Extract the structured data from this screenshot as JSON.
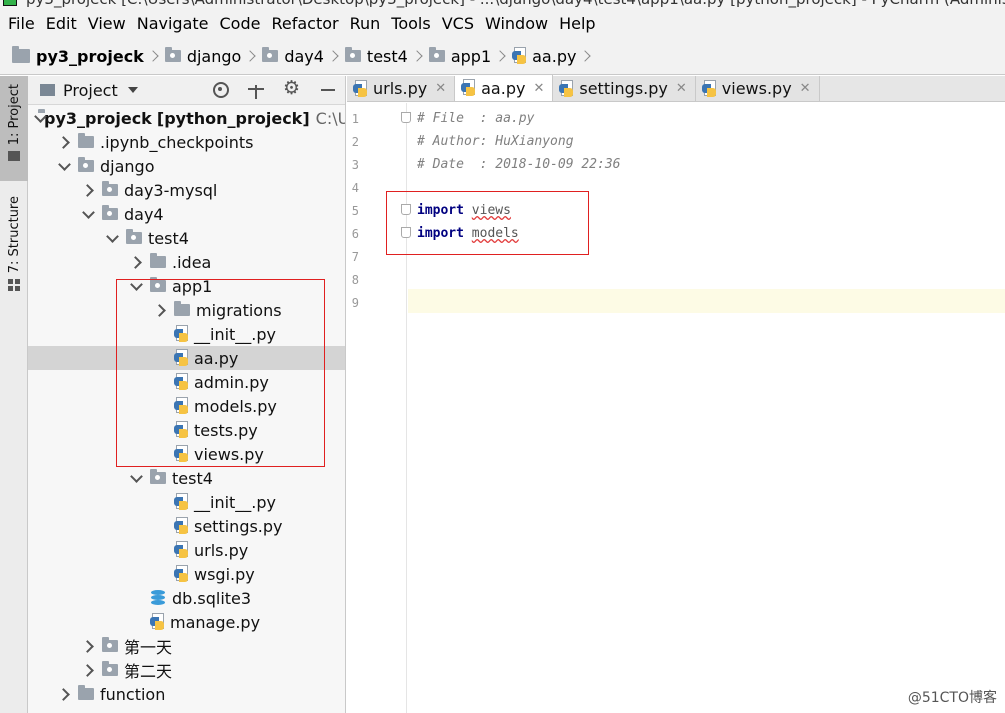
{
  "titlebar": {
    "text": "py3_projeck [C:\\Users\\Administrator\\Desktop\\py3_projeck] - ...\\django\\day4\\test4\\app1\\aa.py [python_projeck] - PyCharm (Administrator)"
  },
  "menu": [
    "File",
    "Edit",
    "View",
    "Navigate",
    "Code",
    "Refactor",
    "Run",
    "Tools",
    "VCS",
    "Window",
    "Help"
  ],
  "breadcrumb": [
    "py3_projeck",
    "django",
    "day4",
    "test4",
    "app1",
    "aa.py"
  ],
  "toolstrip": {
    "project_tab": "1: Project",
    "structure_tab": "7: Structure"
  },
  "project_panel": {
    "title": "Project",
    "root_name": "py3_projeck",
    "root_project": "[python_projeck]",
    "root_path": "C:\\Us",
    "nodes": [
      ".ipynb_checkpoints",
      "django",
      "day3-mysql",
      "day4",
      "test4",
      ".idea",
      "app1",
      "migrations",
      "__init__.py",
      "aa.py",
      "admin.py",
      "models.py",
      "tests.py",
      "views.py",
      "test4",
      "__init__.py",
      "settings.py",
      "urls.py",
      "wsgi.py",
      "db.sqlite3",
      "manage.py",
      "第一天",
      "第二天",
      "function"
    ]
  },
  "editor_tabs": [
    "urls.py",
    "aa.py",
    "settings.py",
    "views.py"
  ],
  "editor": {
    "line_numbers": [
      "1",
      "2",
      "3",
      "4",
      "5",
      "6",
      "7",
      "8",
      "9"
    ],
    "comment_file": "# File  : aa.py",
    "comment_author": "# Author: HuXianyong",
    "comment_date": "# Date  : 2018-10-09 22:36",
    "keyword": "import",
    "module_views": "views",
    "module_models": "models"
  },
  "watermark": "@51CTO博客"
}
